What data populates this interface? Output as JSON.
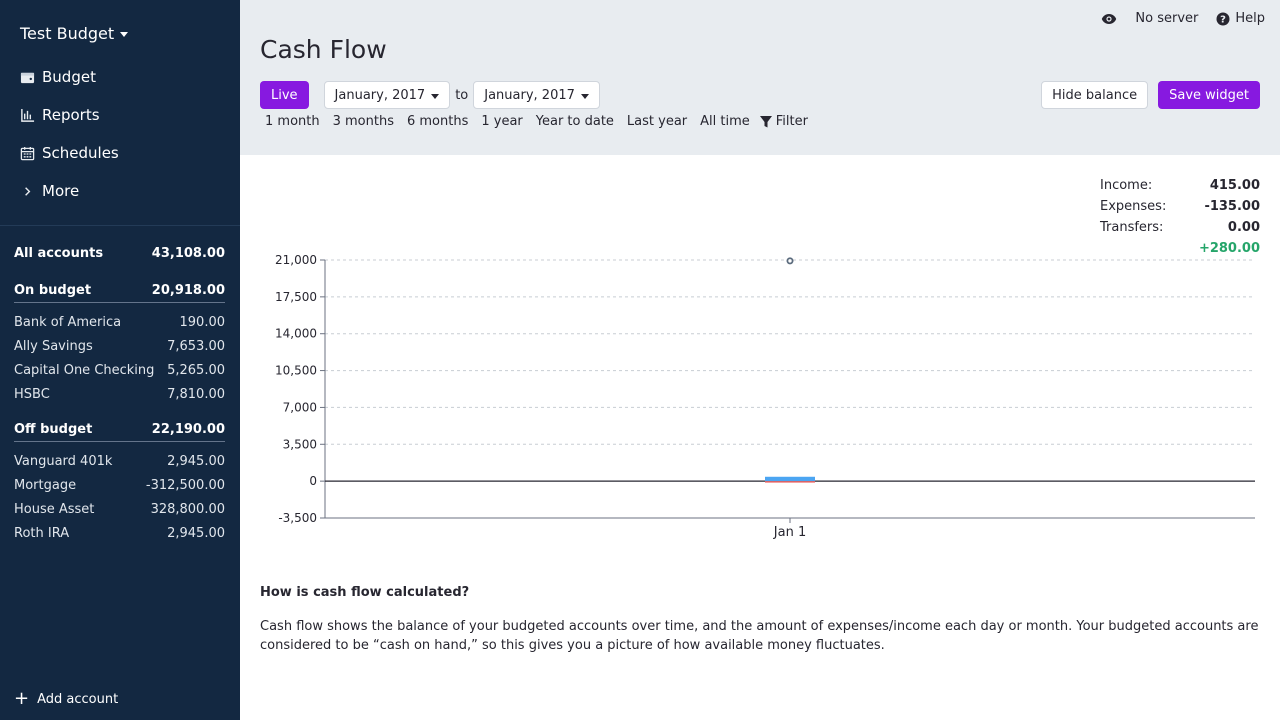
{
  "sidebar": {
    "budget_name": "Test Budget",
    "nav": [
      {
        "label": "Budget",
        "icon": "wallet-icon"
      },
      {
        "label": "Reports",
        "icon": "bar-chart-icon"
      },
      {
        "label": "Schedules",
        "icon": "calendar-icon"
      },
      {
        "label": "More",
        "icon": "chevron-right-icon"
      }
    ],
    "all_accounts": {
      "label": "All accounts",
      "value": "43,108.00"
    },
    "on_budget": {
      "label": "On budget",
      "value": "20,918.00"
    },
    "on_budget_accounts": [
      {
        "name": "Bank of America",
        "value": "190.00"
      },
      {
        "name": "Ally Savings",
        "value": "7,653.00"
      },
      {
        "name": "Capital One Checking",
        "value": "5,265.00"
      },
      {
        "name": "HSBC",
        "value": "7,810.00"
      }
    ],
    "off_budget": {
      "label": "Off budget",
      "value": "22,190.00"
    },
    "off_budget_accounts": [
      {
        "name": "Vanguard 401k",
        "value": "2,945.00"
      },
      {
        "name": "Mortgage",
        "value": "-312,500.00"
      },
      {
        "name": "House Asset",
        "value": "328,800.00"
      },
      {
        "name": "Roth IRA",
        "value": "2,945.00"
      }
    ],
    "add_account": "Add account"
  },
  "topbar": {
    "server": "No server",
    "help": "Help"
  },
  "page": {
    "title": "Cash Flow"
  },
  "controls": {
    "live": "Live",
    "start": "January, 2017",
    "to": "to",
    "end": "January, 2017",
    "hide_balance": "Hide balance",
    "save_widget": "Save widget"
  },
  "ranges": [
    "1 month",
    "3 months",
    "6 months",
    "1 year",
    "Year to date",
    "Last year",
    "All time"
  ],
  "filter_label": "Filter",
  "summary": {
    "income_label": "Income:",
    "income": "415.00",
    "expenses_label": "Expenses:",
    "expenses": "-135.00",
    "transfers_label": "Transfers:",
    "transfers": "0.00",
    "net": "+280.00"
  },
  "chart_data": {
    "type": "bar",
    "categories": [
      "Jan 1"
    ],
    "series": [
      {
        "values": [
          415
        ],
        "color": "#4ba5f2"
      },
      {
        "values": [
          -135
        ],
        "color": "#ef6b6b"
      }
    ],
    "balance": [
      20918
    ],
    "yticks": [
      21000,
      17500,
      14000,
      10500,
      7000,
      3500,
      0,
      -3500
    ],
    "ytick_labels": [
      "21,000",
      "17,500",
      "14,000",
      "10,500",
      "7,000",
      "3,500",
      "0",
      "-3,500"
    ],
    "ylim": [
      -3500,
      21000
    ],
    "grid": true
  },
  "explain": {
    "title": "How is cash flow calculated?",
    "body": "Cash flow shows the balance of your budgeted accounts over time, and the amount of expenses/income each day or month. Your budgeted accounts are considered to be “cash on hand,” so this gives you a picture of how available money fluctuates."
  }
}
